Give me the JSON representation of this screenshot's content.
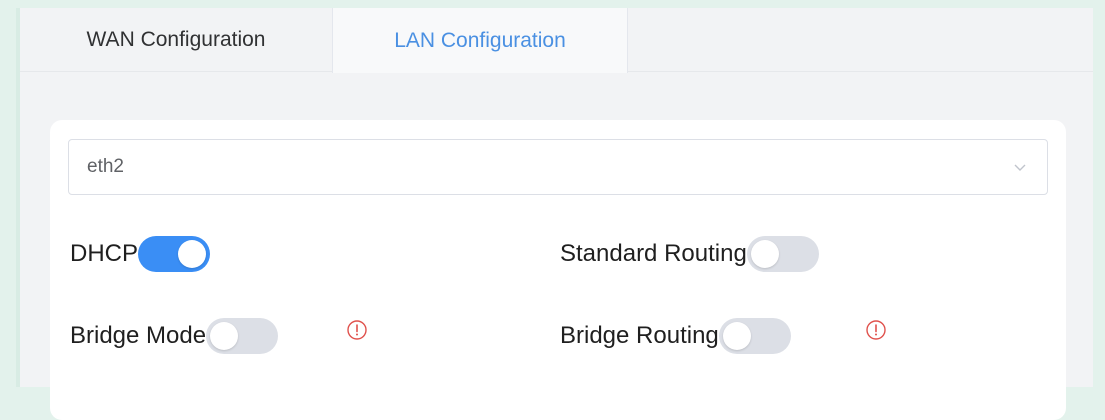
{
  "tabs": [
    {
      "label": "WAN Configuration",
      "active": false
    },
    {
      "label": "LAN Configuration",
      "active": true
    }
  ],
  "interface_select": {
    "value": "eth2",
    "icon": "chevron-down-icon"
  },
  "toggles": {
    "dhcp": {
      "label": "DHCP",
      "on": true
    },
    "standard_routing": {
      "label": "Standard Routing",
      "on": false
    },
    "bridge_mode": {
      "label": "Bridge Mode",
      "on": false,
      "icon": "warning-circle-icon"
    },
    "bridge_routing": {
      "label": "Bridge Routing",
      "on": false,
      "icon": "warning-circle-icon"
    }
  },
  "colors": {
    "accent": "#3a8ef5",
    "tab_active": "#4a90e2",
    "warning": "#e0524d",
    "switch_off": "#dcdfe6"
  }
}
